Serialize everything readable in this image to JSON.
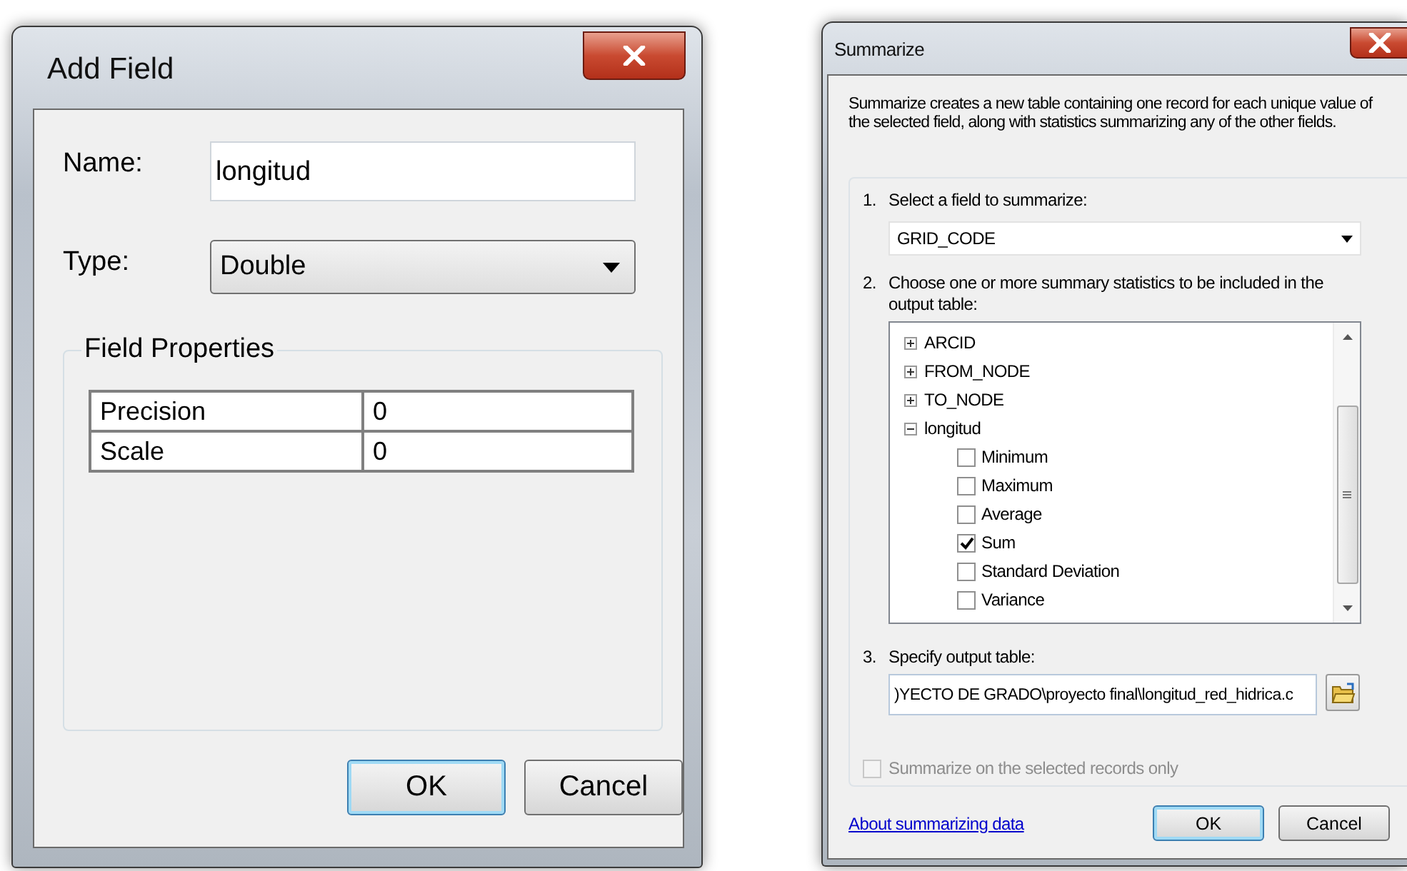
{
  "add_field": {
    "title": "Add Field",
    "name": {
      "label": "Name:",
      "value": "longitud"
    },
    "type": {
      "label": "Type:",
      "value": "Double"
    },
    "field_properties": {
      "title": "Field Properties",
      "rows": [
        {
          "property": "Precision",
          "value": "0"
        },
        {
          "property": "Scale",
          "value": "0"
        }
      ]
    },
    "buttons": [
      {
        "label": "OK",
        "default": true
      },
      {
        "label": "Cancel",
        "default": false
      }
    ]
  },
  "summarize": {
    "title": "Summarize",
    "description": "Summarize creates a new table containing one record for each unique value of the selected field, along with statistics summarizing any of the other fields.",
    "step_1": {
      "number": "1.",
      "label": "Select a field to summarize:",
      "value": "GRID_CODE"
    },
    "step_2": {
      "number": "2.",
      "label": "Choose one or more summary statistics to be included in the output table:",
      "tree": [
        {
          "label": "ARCID",
          "expanded": false
        },
        {
          "label": "FROM_NODE",
          "expanded": false
        },
        {
          "label": "TO_NODE",
          "expanded": false
        },
        {
          "label": "longitud",
          "expanded": true,
          "children": [
            {
              "label": "Minimum",
              "checked": false
            },
            {
              "label": "Maximum",
              "checked": false
            },
            {
              "label": "Average",
              "checked": false
            },
            {
              "label": "Sum",
              "checked": true
            },
            {
              "label": "Standard Deviation",
              "checked": false
            },
            {
              "label": "Variance",
              "checked": false
            }
          ]
        }
      ]
    },
    "step_3": {
      "number": "3.",
      "label": "Specify output table:",
      "value": ")YECTO DE GRADO\\proyecto final\\longitud_red_hidrica.c"
    },
    "selected_only": {
      "label": "Summarize on the selected records only",
      "checked": false,
      "disabled": true
    },
    "help_link": "About summarizing data",
    "buttons": [
      {
        "label": "OK",
        "default": true
      },
      {
        "label": "Cancel",
        "default": false
      }
    ]
  }
}
